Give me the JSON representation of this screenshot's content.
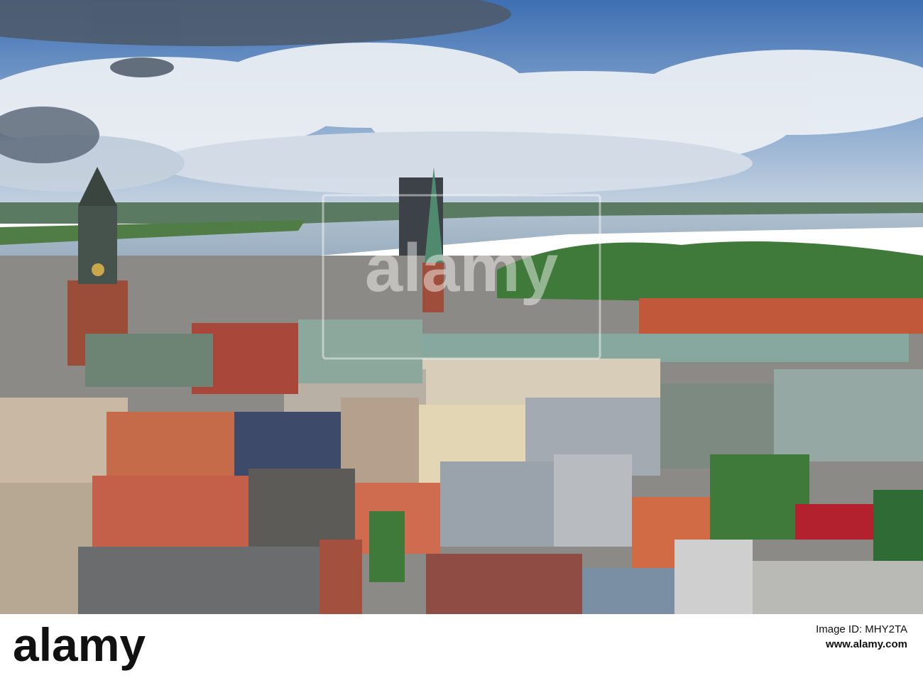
{
  "photo": {
    "subject": "aerial city view",
    "colors": {
      "sky_blue": "#4a7fbf",
      "cloud": "#e8ecf2",
      "river": "#a9bccd",
      "trees": "#3f7a3a",
      "roof_red": "#c2583a",
      "roof_green": "#7fa69a",
      "roof_grey": "#9aa3ab"
    }
  },
  "watermark": {
    "brand": "alamy"
  },
  "footer": {
    "logo_text": "alamy",
    "image_id_label": "Image ID:",
    "image_id_value": "MHY2TA",
    "site_url": "www.alamy.com"
  }
}
